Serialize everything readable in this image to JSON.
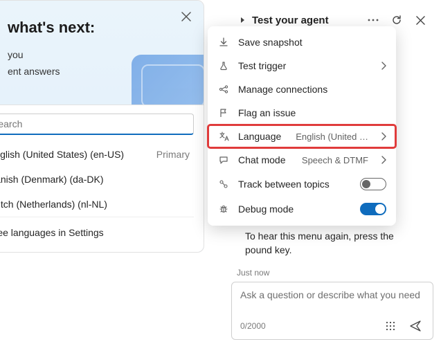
{
  "banner": {
    "title": "what's next:",
    "line1": "you",
    "line2": "ent answers"
  },
  "lang_panel": {
    "search_placeholder": "Search",
    "items": [
      {
        "name": "English (United States) (en-US)",
        "selected": true,
        "tag": "Primary"
      },
      {
        "name": "Danish (Denmark) (da-DK)",
        "selected": false,
        "tag": ""
      },
      {
        "name": "Dutch (Netherlands) (nl-NL)",
        "selected": false,
        "tag": ""
      }
    ],
    "settings_label": "See languages in Settings"
  },
  "header": {
    "title": "Test your agent"
  },
  "menu": {
    "save_snapshot": "Save snapshot",
    "test_trigger": "Test trigger",
    "manage_connections": "Manage connections",
    "flag_issue": "Flag an issue",
    "language_label": "Language",
    "language_value": "English (United …",
    "chat_mode_label": "Chat mode",
    "chat_mode_value": "Speech & DTMF",
    "track_topics": "Track between topics",
    "debug_mode": "Debug mode"
  },
  "chat": {
    "bubble_text": "To hear this menu again, press the pound key.",
    "timestamp": "Just now",
    "placeholder": "Ask a question or describe what you need",
    "counter": "0/2000"
  }
}
